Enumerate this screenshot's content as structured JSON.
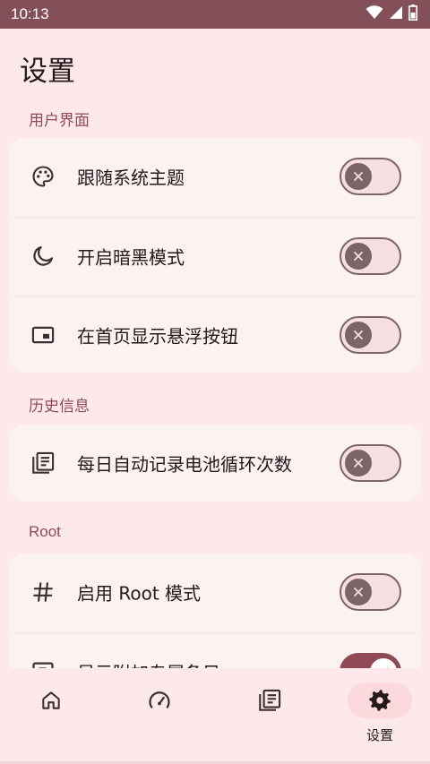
{
  "status_bar": {
    "time": "10:13"
  },
  "page": {
    "title": "设置"
  },
  "sections": [
    {
      "label": "用户界面",
      "items": [
        {
          "icon": "palette-icon",
          "label": "跟随系统主题",
          "enabled": false
        },
        {
          "icon": "moon-icon",
          "label": "开启暗黑模式",
          "enabled": false
        },
        {
          "icon": "picture-in-picture-icon",
          "label": "在首页显示悬浮按钮",
          "enabled": false
        }
      ]
    },
    {
      "label": "历史信息",
      "items": [
        {
          "icon": "list-document-icon",
          "label": "每日自动记录电池循环次数",
          "enabled": false
        }
      ]
    },
    {
      "label": "Root",
      "items": [
        {
          "icon": "hash-icon",
          "label": "启用 Root 模式",
          "enabled": false
        },
        {
          "icon": "badge-icon",
          "label": "显示附加专属条目",
          "enabled": true
        }
      ]
    }
  ],
  "bottom_nav": {
    "items": [
      {
        "icon": "home-icon",
        "label": ""
      },
      {
        "icon": "speedometer-icon",
        "label": ""
      },
      {
        "icon": "list-document-icon",
        "label": ""
      },
      {
        "icon": "gear-icon",
        "label": "设置",
        "active": true
      }
    ]
  },
  "colors": {
    "background": "#fde9eb",
    "card": "#fdf2f2",
    "accent": "#8f4a56",
    "status_bar": "#835059",
    "switch_off_outline": "#7b6567"
  }
}
